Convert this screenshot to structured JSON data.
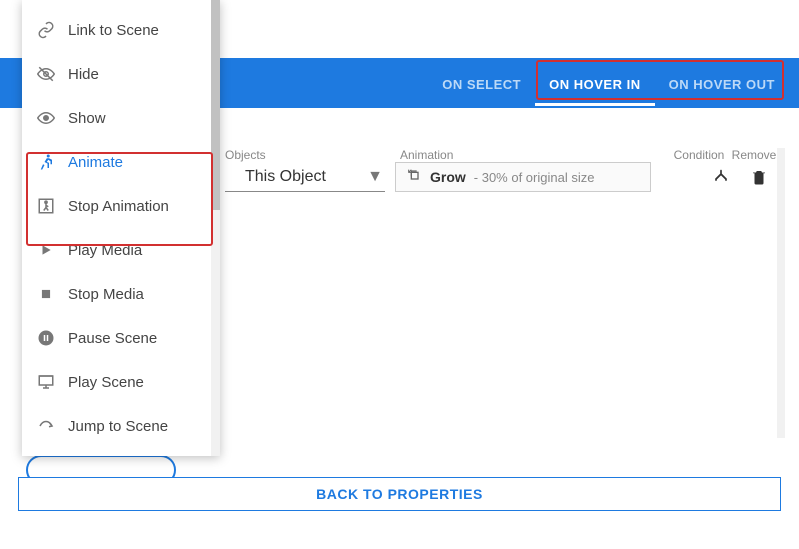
{
  "tabs": {
    "on_select": "ON SELECT",
    "on_hover_in": "ON HOVER IN",
    "on_hover_out": "ON HOVER OUT",
    "active": "on_hover_in"
  },
  "menu": {
    "items": [
      {
        "label": "Link to Scene"
      },
      {
        "label": "Hide"
      },
      {
        "label": "Show"
      },
      {
        "label": "Animate",
        "active": true
      },
      {
        "label": "Stop Animation"
      },
      {
        "label": "Play Media"
      },
      {
        "label": "Stop Media"
      },
      {
        "label": "Pause Scene"
      },
      {
        "label": "Play Scene"
      },
      {
        "label": "Jump to Scene"
      }
    ]
  },
  "row": {
    "labels": {
      "objects": "Objects",
      "animation": "Animation",
      "condition": "Condition",
      "remove": "Remove"
    },
    "object_selected": "This Object",
    "animation_name": "Grow",
    "animation_sub": "- 30% of original size"
  },
  "footer": {
    "back": "BACK TO PROPERTIES"
  }
}
